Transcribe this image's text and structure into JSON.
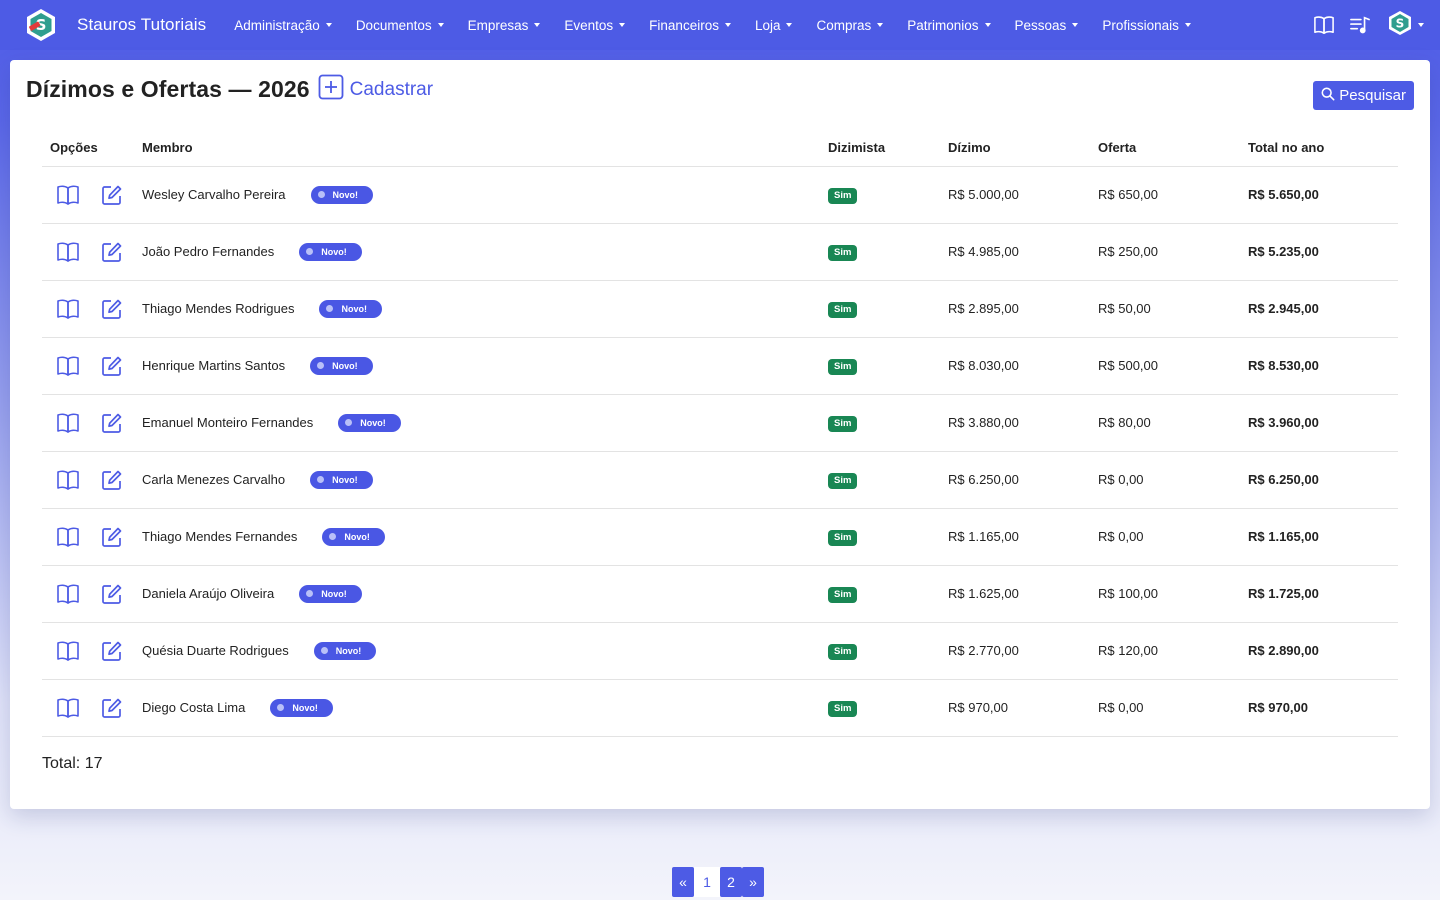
{
  "navbar": {
    "brand": "Stauros Tutoriais",
    "menu": [
      "Administração",
      "Documentos",
      "Empresas",
      "Eventos",
      "Financeiros",
      "Loja",
      "Compras",
      "Patrimonios",
      "Pessoas",
      "Profissionais"
    ],
    "right_icons": [
      "book-icon",
      "playlist-icon",
      "user-logo-icon"
    ]
  },
  "page": {
    "title": "Dízimos e Ofertas — 2026",
    "add_label": "Cadastrar",
    "search_label": "Pesquisar"
  },
  "table": {
    "headers": [
      "Opções",
      "Membro",
      "Dizimista",
      "Dízimo",
      "Oferta",
      "Total no ano"
    ],
    "new_badge": "Novo!",
    "rows": [
      {
        "member": "Wesley Carvalho Pereira",
        "tither": "Sim",
        "tithe": "R$ 5.000,00",
        "offering": "R$ 650,00",
        "total": "R$ 5.650,00"
      },
      {
        "member": "João Pedro Fernandes",
        "tither": "Sim",
        "tithe": "R$ 4.985,00",
        "offering": "R$ 250,00",
        "total": "R$ 5.235,00"
      },
      {
        "member": "Thiago Mendes Rodrigues",
        "tither": "Sim",
        "tithe": "R$ 2.895,00",
        "offering": "R$ 50,00",
        "total": "R$ 2.945,00"
      },
      {
        "member": "Henrique Martins Santos",
        "tither": "Sim",
        "tithe": "R$ 8.030,00",
        "offering": "R$ 500,00",
        "total": "R$ 8.530,00"
      },
      {
        "member": "Emanuel Monteiro Fernandes",
        "tither": "Sim",
        "tithe": "R$ 3.880,00",
        "offering": "R$ 80,00",
        "total": "R$ 3.960,00"
      },
      {
        "member": "Carla Menezes Carvalho",
        "tither": "Sim",
        "tithe": "R$ 6.250,00",
        "offering": "R$ 0,00",
        "total": "R$ 6.250,00"
      },
      {
        "member": "Thiago Mendes Fernandes",
        "tither": "Sim",
        "tithe": "R$ 1.165,00",
        "offering": "R$ 0,00",
        "total": "R$ 1.165,00"
      },
      {
        "member": "Daniela Araújo Oliveira",
        "tither": "Sim",
        "tithe": "R$ 1.625,00",
        "offering": "R$ 100,00",
        "total": "R$ 1.725,00"
      },
      {
        "member": "Quésia Duarte Rodrigues",
        "tither": "Sim",
        "tithe": "R$ 2.770,00",
        "offering": "R$ 120,00",
        "total": "R$ 2.890,00"
      },
      {
        "member": "Diego Costa Lima",
        "tither": "Sim",
        "tithe": "R$ 970,00",
        "offering": "R$ 0,00",
        "total": "R$ 970,00"
      }
    ]
  },
  "summary": {
    "total": "Total: 17"
  },
  "pagination": {
    "prev": "«",
    "pages": [
      "1",
      "2"
    ],
    "active": "2",
    "next": "»"
  },
  "colors": {
    "primary": "#4d5be5",
    "success": "#198754"
  }
}
